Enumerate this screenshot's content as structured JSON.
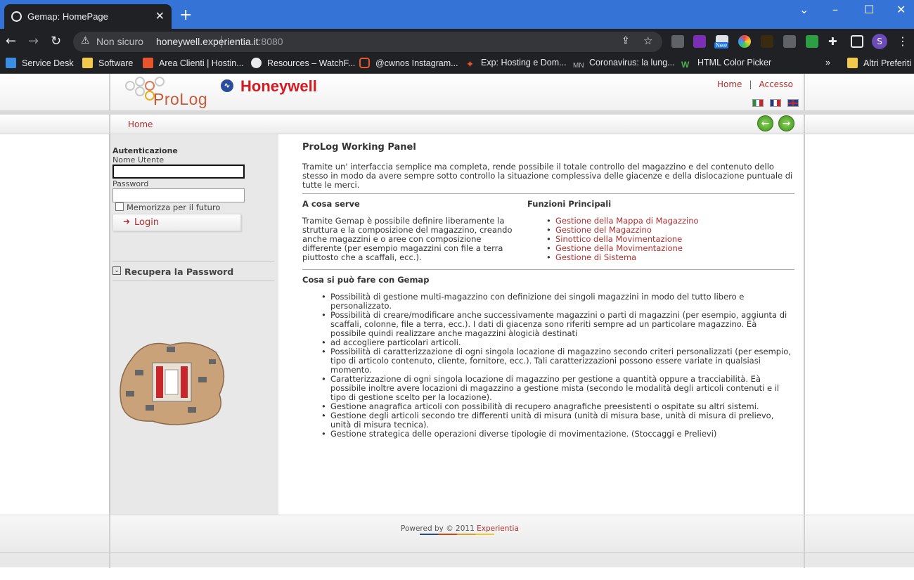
{
  "browser": {
    "tab_title": "Gemap: HomePage",
    "new_tab_symbol": "+",
    "security_label": "Non sicuro",
    "host": "honeywell.experientia.it",
    "port": ":8080",
    "new_badge": "New",
    "profile_initial": "S"
  },
  "bookmarks": [
    {
      "label": "Service Desk"
    },
    {
      "label": "Software"
    },
    {
      "label": "Area Clienti | Hostin..."
    },
    {
      "label": "Resources – WatchF..."
    },
    {
      "label": "@cwnos Instagram..."
    },
    {
      "label": "Exp: Hosting e Dom..."
    },
    {
      "label": "Coronavirus: la lung..."
    },
    {
      "label": "HTML Color Picker"
    },
    {
      "label": "»"
    },
    {
      "label": "Altri Preferiti"
    }
  ],
  "header": {
    "prolog_logo_text": "ProLog",
    "honeywell_logo_text": "Honeywell",
    "link_home": "Home",
    "separator": "|",
    "link_accesso": "Accesso"
  },
  "navbar": {
    "home": "Home"
  },
  "sidebar": {
    "auth_title": "Autenticazione",
    "username_label": "Nome Utente",
    "username_value": "",
    "password_label": "Password",
    "password_value": "",
    "remember_label": "Memorizza per il futuro",
    "login_label": "Login",
    "recover_label": "Recupera la Password"
  },
  "main": {
    "title": "ProLog Working Panel",
    "intro": "Tramite un' interfaccia semplice ma completa, rende possibile il totale controllo del magazzino e del contenuto dello stesso in modo da avere sempre sotto controllo la situazione complessiva delle giacenze e della dislocazione puntuale di tutte le merci.",
    "a_cosa_serve_title": "A cosa serve",
    "a_cosa_serve_text": "Tramite Gemap è possibile definire liberamente la struttura e la composizione del magazzino, creando anche magazzini e o aree con composizione differente (per esempio magazzini con file a terra piuttosto che a scaffali, ecc.).",
    "funzioni_title": "Funzioni Principali",
    "funzioni": [
      "Gestione della Mappa di Magazzino",
      "Gestione del Magazzino",
      "Sinottico della Movimentazione",
      "Gestione della Movimentazione",
      "Gestione di Sistema"
    ],
    "cosa_title": "Cosa si può fare con Gemap",
    "cosa_items": [
      "Possibilità di gestione multi-magazzino con definizione dei singoli magazzini in modo del tutto libero e personalizzato.",
      "Possibilità di creare/modificare anche successivamente magazzini o parti di magazzini (per esempio, aggiunta di scaffali, colonne, file a terra, ecc.). I dati di giacenza sono riferiti sempre ad un particolare magazzino. Eà possibile quindi realizzare anche magazzini àlogicià destinati",
      "ad accogliere particolari articoli.",
      "Possibilità di caratterizzazione di ogni singola locazione di magazzino secondo criteri personalizzati (per esempio, tipo di articolo contenuto, cliente, fornitore, ecc.). Tali caratterizzazioni possono essere variate in qualsiasi momento.",
      "Caratterizzazione di ogni singola locazione di magazzino per gestione a quantità oppure a tracciabilità. Eà possibile inoltre avere locazioni di magazzino a gestione mista (secondo le modalità degli articoli contenuti e il tipo di gestione scelto per la locazione).",
      "Gestione anagrafica articoli con possibilità di recupero anagrafiche preesistenti o ospitate su altri sistemi.",
      "Gestione degli articoli secondo tre differenti unità di misura (unità di misura base, unità di misura di prelievo, unità di misura tecnica).",
      "Gestione strategica delle operazioni diverse tipologie di movimentazione. (Stoccaggi e Prelievi)"
    ]
  },
  "footer": {
    "powered": "Powered by © 2011 ",
    "brand": "Experientia"
  },
  "colors": {
    "link": "#b03030",
    "chrome_blue": "#3574d6",
    "chrome_dark": "#202124"
  }
}
